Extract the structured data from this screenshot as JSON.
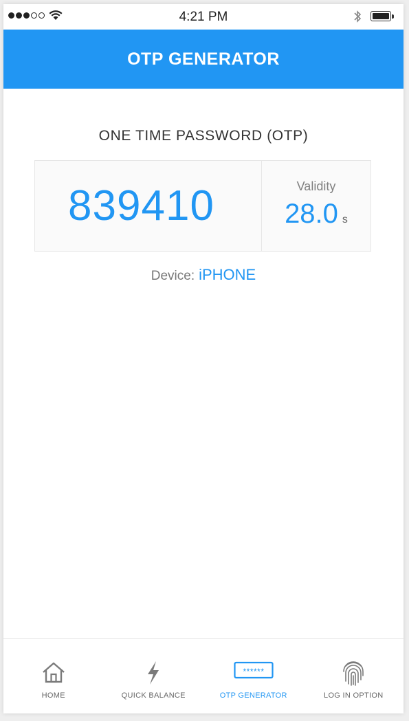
{
  "status_bar": {
    "time": "4:21 PM",
    "signal_bars_filled": 3,
    "signal_bars_total": 5
  },
  "header": {
    "title": "OTP GENERATOR",
    "color": "#2196f3"
  },
  "otp": {
    "heading": "ONE TIME PASSWORD (OTP)",
    "code": "839410",
    "validity_label": "Validity",
    "validity_value": "28.0",
    "validity_unit": "s"
  },
  "device": {
    "label": "Device:",
    "value": "iPHONE"
  },
  "bottom_nav": {
    "items": [
      {
        "label": "HOME",
        "icon": "home-icon"
      },
      {
        "label": "QUICK BALANCE",
        "icon": "lightning-icon"
      },
      {
        "label": "OTP GENERATOR",
        "icon": "password-icon",
        "active": true
      },
      {
        "label": "LOG IN OPTION",
        "icon": "fingerprint-icon"
      }
    ]
  }
}
